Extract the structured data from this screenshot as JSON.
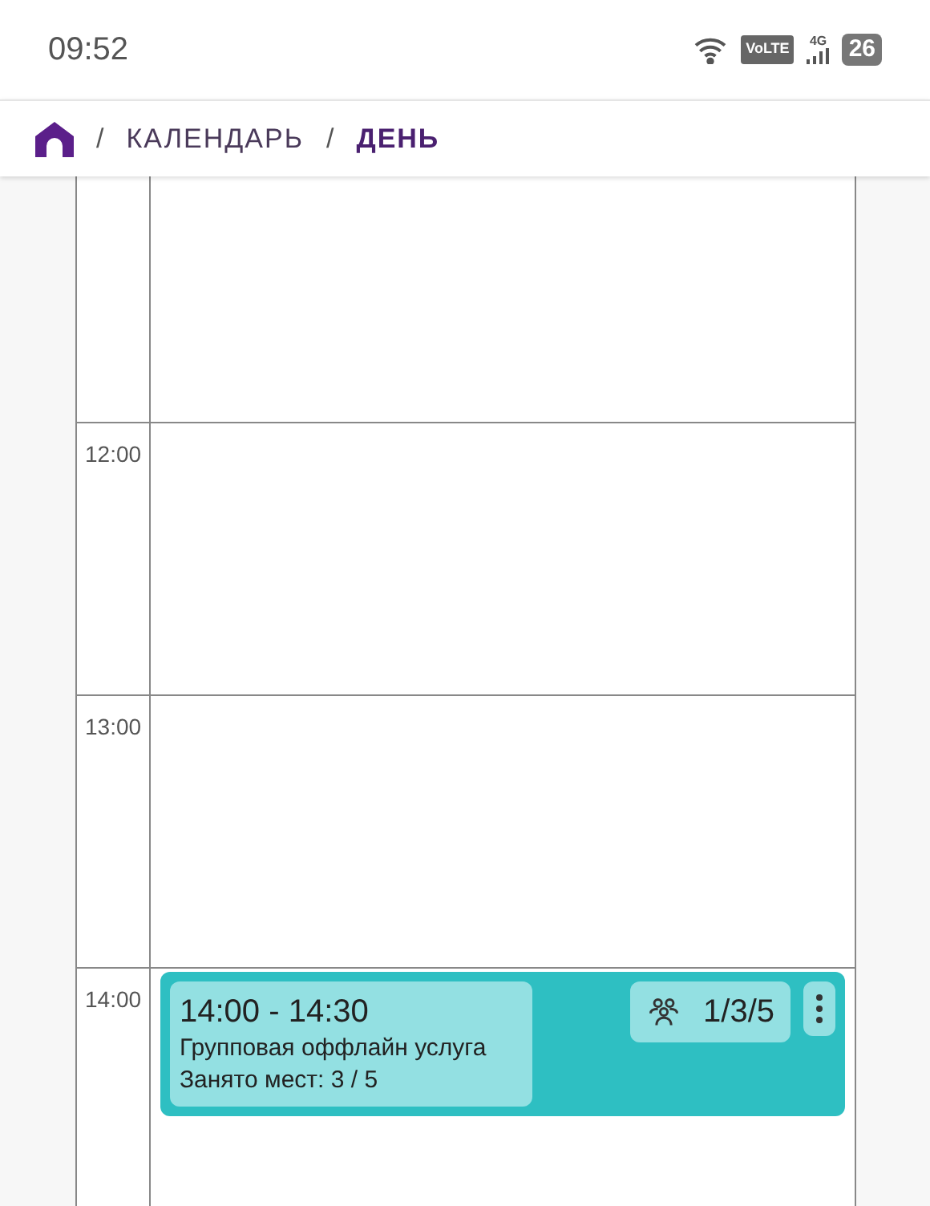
{
  "status_bar": {
    "time": "09:52",
    "volte": "VoLTE",
    "network": "4G",
    "battery": "26"
  },
  "breadcrumb": [
    {
      "separator": "/",
      "label": "КАЛЕНДАРЬ",
      "selected": false
    },
    {
      "separator": "/",
      "label": "ДЕНЬ",
      "selected": true
    }
  ],
  "hours": [
    {
      "label": "12:00"
    },
    {
      "label": "13:00"
    },
    {
      "label": "14:00",
      "event": {
        "time": "14:00 - 14:30",
        "title": "Групповая оффлайн услуга",
        "seats": "Занято мест: 3 / 5",
        "count": "1/3/5"
      }
    }
  ]
}
